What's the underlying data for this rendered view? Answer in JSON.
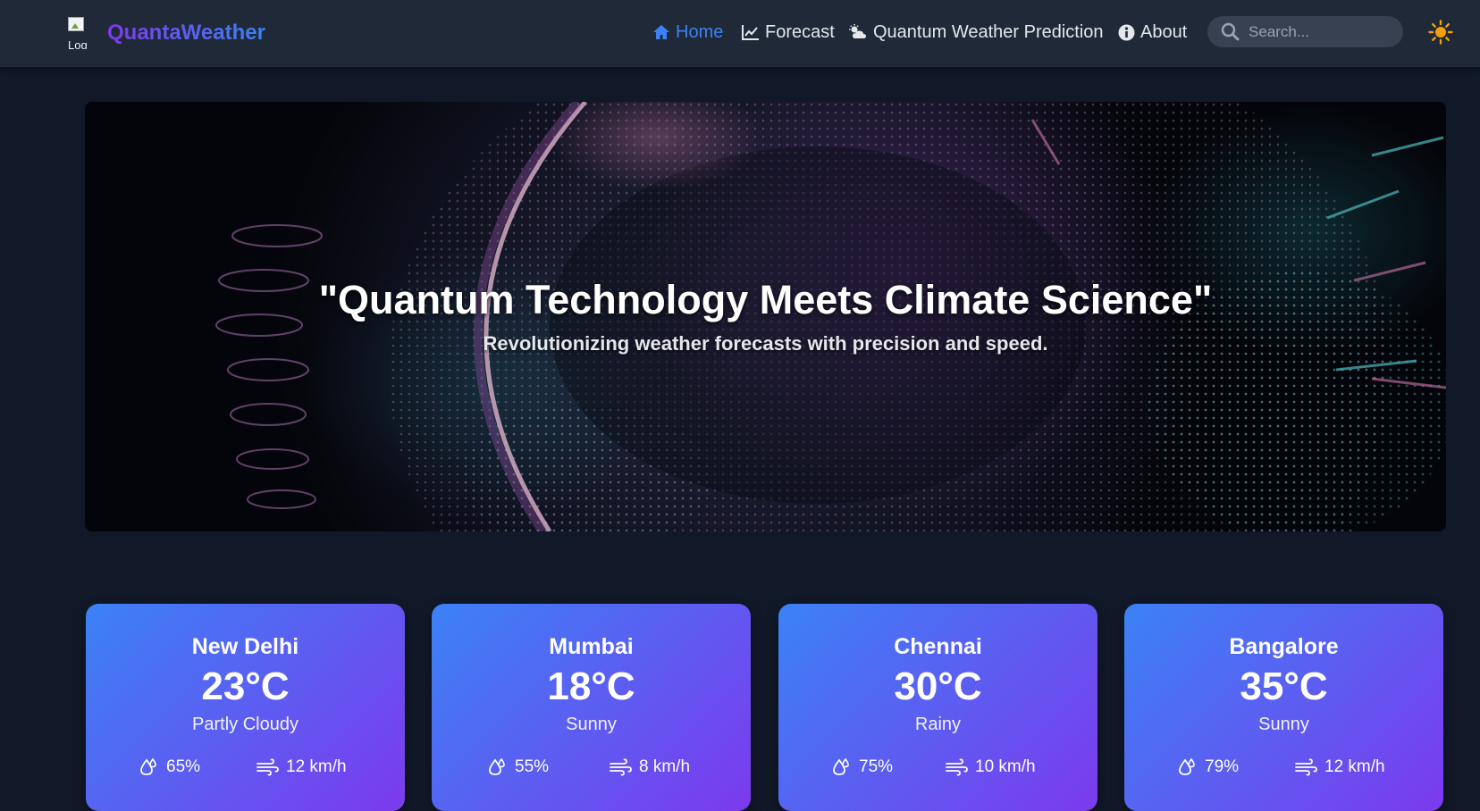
{
  "header": {
    "logo_alt": "Log",
    "brand": "QuantaWeather",
    "nav": [
      {
        "label": "Home",
        "icon": "home-icon",
        "active": true
      },
      {
        "label": "Forecast",
        "icon": "chart-line-icon"
      },
      {
        "label": "Quantum Weather Prediction",
        "icon": "cloud-sun-icon"
      },
      {
        "label": "About",
        "icon": "info-circle-icon"
      }
    ],
    "search": {
      "placeholder": "Search...",
      "value": ""
    },
    "theme_toggle_icon": "sun-icon"
  },
  "hero": {
    "title": "\"Quantum Technology Meets Climate Science\"",
    "subtitle": "Revolutionizing weather forecasts with precision and speed."
  },
  "cities": [
    {
      "city": "New Delhi",
      "temp": "23°C",
      "condition": "Partly Cloudy",
      "humidity": "65%",
      "wind": "12 km/h"
    },
    {
      "city": "Mumbai",
      "temp": "18°C",
      "condition": "Sunny",
      "humidity": "55%",
      "wind": "8 km/h"
    },
    {
      "city": "Chennai",
      "temp": "30°C",
      "condition": "Rainy",
      "humidity": "75%",
      "wind": "10 km/h"
    },
    {
      "city": "Bangalore",
      "temp": "35°C",
      "condition": "Sunny",
      "humidity": "79%",
      "wind": "12 km/h"
    }
  ],
  "colors": {
    "background": "#111827",
    "navbar": "#1f2937",
    "accent": "#3b82f6",
    "card_gradient_start": "#3b82f6",
    "card_gradient_end": "#7c3aed",
    "sun": "#f59e0b"
  }
}
